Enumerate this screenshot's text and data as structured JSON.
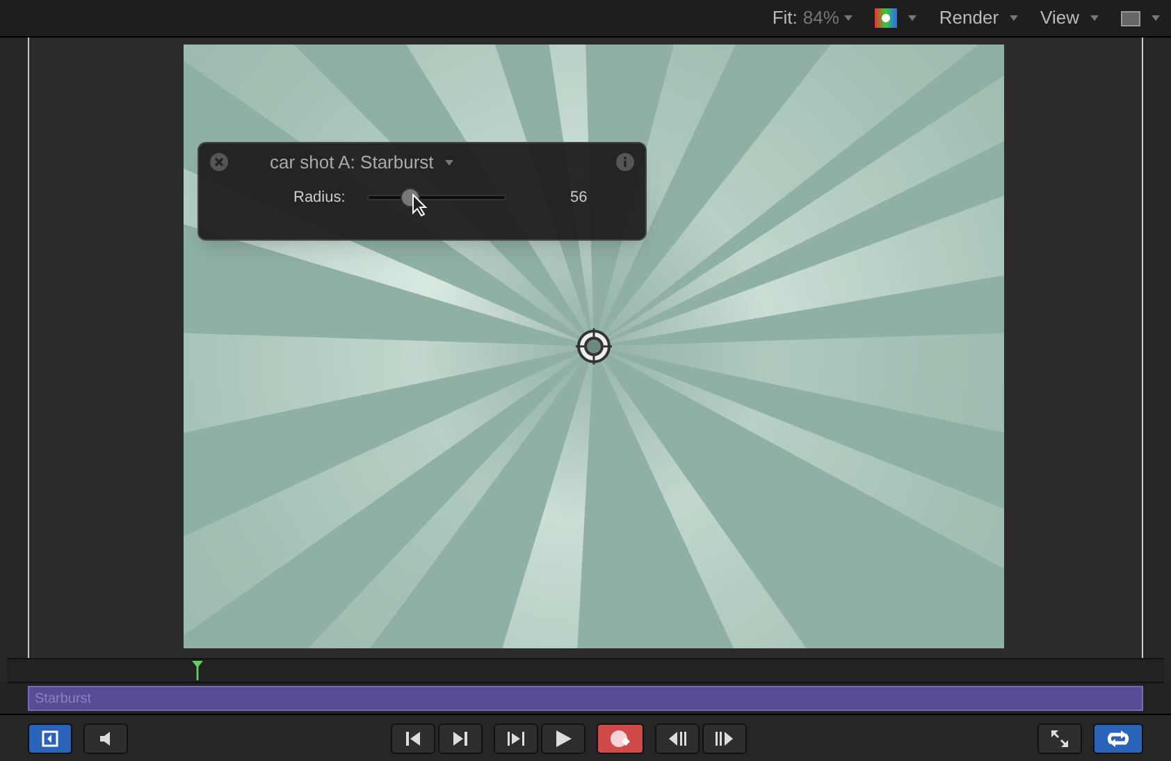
{
  "toolbar": {
    "fit_label": "Fit:",
    "fit_value": "84%",
    "render": "Render",
    "view": "View"
  },
  "hud": {
    "title": "car shot A: Starburst",
    "param": {
      "label": "Radius:",
      "level": 0.31,
      "reading": "56"
    }
  },
  "timeline": {
    "clip": "Starburst"
  },
  "transport": {
    "left": [
      {
        "kind": "panel",
        "on": true
      },
      {
        "kind": "audio",
        "on": false
      }
    ],
    "center": [
      [
        {
          "kind": "start",
          "on": false
        },
        {
          "kind": "end",
          "on": false
        }
      ],
      [
        {
          "kind": "playrange",
          "on": false
        },
        {
          "kind": "play",
          "on": false
        }
      ],
      [
        {
          "kind": "record",
          "on": true
        }
      ],
      [
        {
          "kind": "prevframe",
          "on": false
        },
        {
          "kind": "nextframe",
          "on": false
        }
      ]
    ],
    "right": [
      {
        "kind": "fullscreen",
        "on": false
      },
      {
        "kind": "loop",
        "on": true
      }
    ]
  }
}
